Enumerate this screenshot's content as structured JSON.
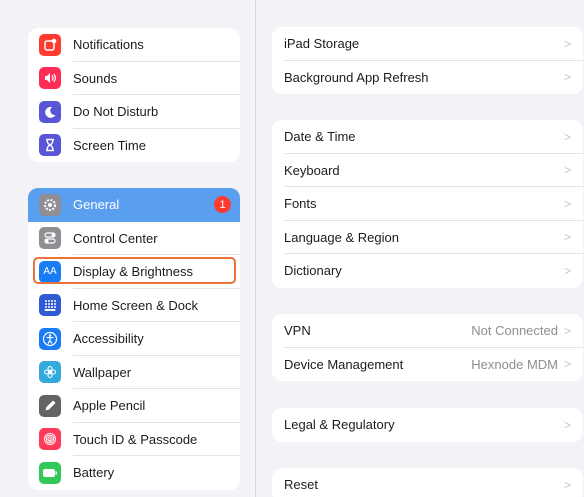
{
  "sidebar": {
    "group1": [
      {
        "label": "Notifications",
        "icon": "notifications-icon",
        "color": "#ff3b30"
      },
      {
        "label": "Sounds",
        "icon": "sounds-icon",
        "color": "#ff2d55"
      },
      {
        "label": "Do Not Disturb",
        "icon": "moon-icon",
        "color": "#5856d6"
      },
      {
        "label": "Screen Time",
        "icon": "hourglass-icon",
        "color": "#5856d6"
      }
    ],
    "group2": [
      {
        "label": "General",
        "icon": "gear-icon",
        "color": "#8e8e93",
        "badge": "1"
      },
      {
        "label": "Control Center",
        "icon": "toggles-icon",
        "color": "#8e8e93"
      },
      {
        "label": "Display & Brightness",
        "icon": "display-icon",
        "color": "#1a7cf3",
        "icon_text": "AA"
      },
      {
        "label": "Home Screen & Dock",
        "icon": "grid-icon",
        "color": "#2f5bd6"
      },
      {
        "label": "Accessibility",
        "icon": "accessibility-icon",
        "color": "#1a7cf3"
      },
      {
        "label": "Wallpaper",
        "icon": "flower-icon",
        "color": "#34aadc"
      },
      {
        "label": "Apple Pencil",
        "icon": "pencil-icon",
        "color": "#636366"
      },
      {
        "label": "Touch ID & Passcode",
        "icon": "fingerprint-icon",
        "color": "#ff3b5c"
      },
      {
        "label": "Battery",
        "icon": "battery-icon",
        "color": "#34c759"
      }
    ],
    "selected_color": "#5a9ef0",
    "highlight_color": "#e8743a"
  },
  "detail": {
    "group1": [
      {
        "label": "iPad Storage"
      },
      {
        "label": "Background App Refresh"
      }
    ],
    "group2": [
      {
        "label": "Date & Time"
      },
      {
        "label": "Keyboard"
      },
      {
        "label": "Fonts"
      },
      {
        "label": "Language & Region"
      },
      {
        "label": "Dictionary"
      }
    ],
    "group3": [
      {
        "label": "VPN",
        "value": "Not Connected"
      },
      {
        "label": "Device Management",
        "value": "Hexnode MDM"
      }
    ],
    "group4": [
      {
        "label": "Legal & Regulatory"
      }
    ],
    "group5": [
      {
        "label": "Reset"
      }
    ],
    "chevron": ">"
  }
}
